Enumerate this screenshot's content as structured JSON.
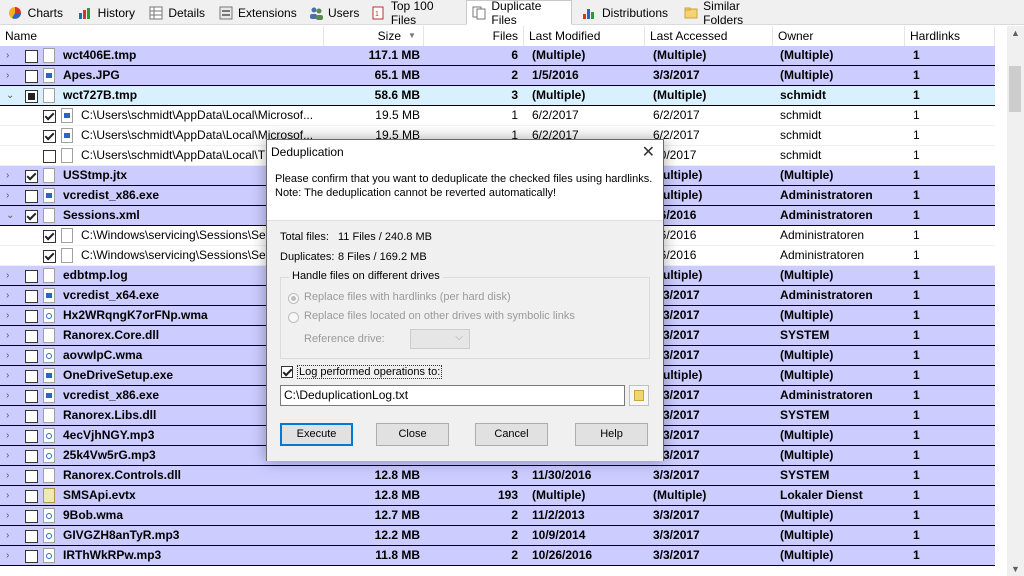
{
  "tabs": [
    {
      "label": "Charts",
      "icon": "pie-chart-icon",
      "active": false
    },
    {
      "label": "History",
      "icon": "history-chart-icon",
      "active": false
    },
    {
      "label": "Details",
      "icon": "details-grid-icon",
      "active": false
    },
    {
      "label": "Extensions",
      "icon": "extensions-icon",
      "active": false
    },
    {
      "label": "Users",
      "icon": "users-icon",
      "active": false
    },
    {
      "label": "Top 100 Files",
      "icon": "top-files-icon",
      "active": false
    },
    {
      "label": "Duplicate Files",
      "icon": "duplicate-files-icon",
      "active": true
    },
    {
      "label": "Distributions",
      "icon": "distributions-icon",
      "active": false
    },
    {
      "label": "Similar Folders",
      "icon": "similar-folders-icon",
      "active": false
    }
  ],
  "columns": {
    "name": "Name",
    "size": "Size",
    "files": "Files",
    "last_modified": "Last Modified",
    "last_accessed": "Last Accessed",
    "owner": "Owner",
    "hardlinks": "Hardlinks"
  },
  "rows": [
    {
      "type": "group",
      "expanded": false,
      "check": "unchecked",
      "icon": "file-icon",
      "name": "wct406E.tmp",
      "size": "117.1 MB",
      "files": "6",
      "modified": "(Multiple)",
      "accessed": "(Multiple)",
      "owner": "(Multiple)",
      "hardlinks": "1"
    },
    {
      "type": "group",
      "expanded": false,
      "check": "unchecked",
      "icon": "image-file-icon",
      "name": "Apes.JPG",
      "size": "65.1 MB",
      "files": "2",
      "modified": "1/5/2016",
      "accessed": "3/3/2017",
      "owner": "(Multiple)",
      "hardlinks": "1"
    },
    {
      "type": "group",
      "expanded": true,
      "selected": true,
      "check": "partial",
      "icon": "file-icon",
      "name": "wct727B.tmp",
      "size": "58.6 MB",
      "files": "3",
      "modified": "(Multiple)",
      "accessed": "(Multiple)",
      "owner": "schmidt",
      "hardlinks": "1"
    },
    {
      "type": "child",
      "check": "checked",
      "icon": "app-file-icon",
      "name": "C:\\Users\\schmidt\\AppData\\Local\\Microsof...",
      "size": "19.5 MB",
      "files": "1",
      "modified": "6/2/2017",
      "accessed": "6/2/2017",
      "owner": "schmidt",
      "hardlinks": "1"
    },
    {
      "type": "child",
      "check": "checked",
      "icon": "app-file-icon",
      "name": "C:\\Users\\schmidt\\AppData\\Local\\Microsof...",
      "size": "19.5 MB",
      "files": "1",
      "modified": "6/2/2017",
      "accessed": "6/2/2017",
      "owner": "schmidt",
      "hardlinks": "1"
    },
    {
      "type": "child",
      "check": "unchecked",
      "icon": "file-icon",
      "name": "C:\\Users\\schmidt\\AppData\\Local\\T",
      "size": "",
      "files": "",
      "modified": "",
      "accessed": "30/2017",
      "owner": "schmidt",
      "hardlinks": "1"
    },
    {
      "type": "group",
      "expanded": false,
      "check": "checked",
      "icon": "file-icon",
      "name": "USStmp.jtx",
      "size": "",
      "files": "",
      "modified": "",
      "accessed": "Multiple)",
      "owner": "(Multiple)",
      "hardlinks": "1"
    },
    {
      "type": "group",
      "expanded": false,
      "check": "unchecked",
      "icon": "app-file-icon",
      "name": "vcredist_x86.exe",
      "size": "",
      "files": "",
      "modified": "",
      "accessed": "Multiple)",
      "owner": "Administratoren",
      "hardlinks": "1"
    },
    {
      "type": "group",
      "expanded": true,
      "check": "checked",
      "icon": "settings-file-icon",
      "name": "Sessions.xml",
      "size": "",
      "files": "",
      "modified": "",
      "accessed": "16/2016",
      "owner": "Administratoren",
      "hardlinks": "1"
    },
    {
      "type": "child",
      "check": "checked",
      "icon": "settings-file-icon",
      "name": "C:\\Windows\\servicing\\Sessions\\Sess",
      "size": "",
      "files": "",
      "modified": "",
      "accessed": "16/2016",
      "owner": "Administratoren",
      "hardlinks": "1"
    },
    {
      "type": "child",
      "check": "checked",
      "icon": "settings-file-icon",
      "name": "C:\\Windows\\servicing\\Sessions\\Sess",
      "size": "",
      "files": "",
      "modified": "",
      "accessed": "16/2016",
      "owner": "Administratoren",
      "hardlinks": "1"
    },
    {
      "type": "group",
      "expanded": false,
      "check": "unchecked",
      "icon": "file-icon",
      "name": "edbtmp.log",
      "size": "",
      "files": "",
      "modified": "",
      "accessed": "Multiple)",
      "owner": "(Multiple)",
      "hardlinks": "1"
    },
    {
      "type": "group",
      "expanded": false,
      "check": "unchecked",
      "icon": "app-file-icon",
      "name": "vcredist_x64.exe",
      "size": "",
      "files": "",
      "modified": "",
      "accessed": "3/3/2017",
      "owner": "Administratoren",
      "hardlinks": "1"
    },
    {
      "type": "group",
      "expanded": false,
      "check": "unchecked",
      "icon": "media-file-icon",
      "name": "Hx2WRqngK7orFNp.wma",
      "size": "",
      "files": "",
      "modified": "",
      "accessed": "3/3/2017",
      "owner": "(Multiple)",
      "hardlinks": "1"
    },
    {
      "type": "group",
      "expanded": false,
      "check": "unchecked",
      "icon": "settings-file-icon",
      "name": "Ranorex.Core.dll",
      "size": "",
      "files": "",
      "modified": "",
      "accessed": "3/3/2017",
      "owner": "SYSTEM",
      "hardlinks": "1"
    },
    {
      "type": "group",
      "expanded": false,
      "check": "unchecked",
      "icon": "media-file-icon",
      "name": "aovwIpC.wma",
      "size": "",
      "files": "",
      "modified": "",
      "accessed": "3/3/2017",
      "owner": "(Multiple)",
      "hardlinks": "1"
    },
    {
      "type": "group",
      "expanded": false,
      "check": "unchecked",
      "icon": "app-file-icon",
      "name": "OneDriveSetup.exe",
      "size": "",
      "files": "",
      "modified": "",
      "accessed": "Multiple)",
      "owner": "(Multiple)",
      "hardlinks": "1"
    },
    {
      "type": "group",
      "expanded": false,
      "check": "unchecked",
      "icon": "app-file-icon",
      "name": "vcredist_x86.exe",
      "size": "",
      "files": "",
      "modified": "",
      "accessed": "3/3/2017",
      "owner": "Administratoren",
      "hardlinks": "1"
    },
    {
      "type": "group",
      "expanded": false,
      "check": "unchecked",
      "icon": "settings-file-icon",
      "name": "Ranorex.Libs.dll",
      "size": "",
      "files": "",
      "modified": "",
      "accessed": "3/3/2017",
      "owner": "SYSTEM",
      "hardlinks": "1"
    },
    {
      "type": "group",
      "expanded": false,
      "check": "unchecked",
      "icon": "media-file-icon",
      "name": "4ecVjhNGY.mp3",
      "size": "",
      "files": "",
      "modified": "",
      "accessed": "3/3/2017",
      "owner": "(Multiple)",
      "hardlinks": "1"
    },
    {
      "type": "group",
      "expanded": false,
      "check": "unchecked",
      "icon": "media-file-icon",
      "name": "25k4Vw5rG.mp3",
      "size": "",
      "files": "",
      "modified": "",
      "accessed": "3/3/2017",
      "owner": "(Multiple)",
      "hardlinks": "1"
    },
    {
      "type": "group",
      "expanded": false,
      "check": "unchecked",
      "icon": "settings-file-icon",
      "name": "Ranorex.Controls.dll",
      "size": "12.8 MB",
      "files": "3",
      "modified": "11/30/2016",
      "accessed": "3/3/2017",
      "owner": "SYSTEM",
      "hardlinks": "1"
    },
    {
      "type": "group",
      "expanded": false,
      "check": "unchecked",
      "icon": "event-file-icon",
      "name": "SMSApi.evtx",
      "size": "12.8 MB",
      "files": "193",
      "modified": "(Multiple)",
      "accessed": "(Multiple)",
      "owner": "Lokaler Dienst",
      "hardlinks": "1"
    },
    {
      "type": "group",
      "expanded": false,
      "check": "unchecked",
      "icon": "media-file-icon",
      "name": "9Bob.wma",
      "size": "12.7 MB",
      "files": "2",
      "modified": "11/2/2013",
      "accessed": "3/3/2017",
      "owner": "(Multiple)",
      "hardlinks": "1"
    },
    {
      "type": "group",
      "expanded": false,
      "check": "unchecked",
      "icon": "media-file-icon",
      "name": "GIVGZH8anTyR.mp3",
      "size": "12.2 MB",
      "files": "2",
      "modified": "10/9/2014",
      "accessed": "3/3/2017",
      "owner": "(Multiple)",
      "hardlinks": "1"
    },
    {
      "type": "group",
      "expanded": false,
      "check": "unchecked",
      "icon": "media-file-icon",
      "name": "IRThWkRPw.mp3",
      "size": "11.8 MB",
      "files": "2",
      "modified": "10/26/2016",
      "accessed": "3/3/2017",
      "owner": "(Multiple)",
      "hardlinks": "1"
    }
  ],
  "dialog": {
    "title": "Deduplication",
    "message_line1": "Please confirm that you want to deduplicate the checked files using hardlinks.",
    "message_line2": "Note: The deduplication cannot be reverted automatically!",
    "total_files_label": "Total files:",
    "total_files_value": "11 Files / 240.8 MB",
    "duplicates_label": "Duplicates:",
    "duplicates_value": "8 Files / 169.2 MB",
    "group_title": "Handle files on different drives",
    "option_hardlinks": "Replace files with hardlinks (per hard disk)",
    "option_symlinks": "Replace files located on other drives with symbolic links",
    "reference_drive_label": "Reference drive:",
    "reference_drive_value": "",
    "log_label": "Log performed operations to:",
    "log_checked": true,
    "log_path": "C:\\DeduplicationLog.txt",
    "buttons": {
      "execute": "Execute",
      "close": "Close",
      "cancel": "Cancel",
      "help": "Help"
    }
  },
  "colors": {
    "group_row": "#ccccff",
    "selected_row": "#d9f0ff",
    "accent": "#0078d7"
  }
}
